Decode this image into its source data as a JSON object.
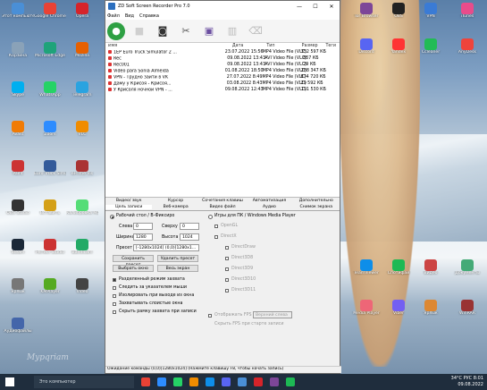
{
  "desktop": {
    "icons_left": [
      {
        "label": "Этот компьютер",
        "color": "#4a8fd6"
      },
      {
        "label": "Google Chrome",
        "color": "#e94235"
      },
      {
        "label": "Opera",
        "color": "#d6242a"
      },
      {
        "label": "Корзина",
        "color": "#8aa2b8"
      },
      {
        "label": "Microsoft Edge",
        "color": "#1fa37a"
      },
      {
        "label": "Mozilla",
        "color": "#e66000"
      },
      {
        "label": "Skype",
        "color": "#00aff0"
      },
      {
        "label": "WhatsApp",
        "color": "#25d366"
      },
      {
        "label": "Telegram",
        "color": "#2aa3e0"
      },
      {
        "label": "Avast",
        "color": "#f07b05"
      },
      {
        "label": "Zoom",
        "color": "#2d8cff"
      },
      {
        "label": "VLC",
        "color": "#f08c00"
      },
      {
        "label": "Paint",
        "color": "#c33"
      },
      {
        "label": "Euro Truck Simulator 2",
        "color": "#335a9a"
      },
      {
        "label": "ePrime Vis",
        "color": "#a33"
      },
      {
        "label": "OBS Studio",
        "color": "#333"
      },
      {
        "label": "Вставить",
        "color": "#d4a017"
      },
      {
        "label": "Калибровка Monitor",
        "color": "#5d7"
      },
      {
        "label": "Steam",
        "color": "#1b2838"
      },
      {
        "label": "Perfect Studio",
        "color": "#c33"
      },
      {
        "label": "Bandicam",
        "color": "#2a6"
      },
      {
        "label": "Ярлык",
        "color": "#777"
      },
      {
        "label": "KMPlayer",
        "color": "#5a2"
      },
      {
        "label": "Video",
        "color": "#444"
      },
      {
        "label": "Аудиофайлы",
        "color": "#46a"
      }
    ],
    "icons_right": [
      {
        "label": "Tor Browser",
        "color": "#7d4698"
      },
      {
        "label": "OBS",
        "color": "#222"
      },
      {
        "label": "VPN",
        "color": "#3a7bd5"
      },
      {
        "label": "iTunes",
        "color": "#e84c8b"
      },
      {
        "label": "Discord",
        "color": "#5865f2"
      },
      {
        "label": "Yandex",
        "color": "#f33"
      },
      {
        "label": "Ccleaner",
        "color": "#2b5"
      },
      {
        "label": "AnyDesk",
        "color": "#ef443b"
      },
      {
        "label": "TeamViewer",
        "color": "#0e8ee9"
      },
      {
        "label": "Спотифай",
        "color": "#1db954"
      },
      {
        "label": "Видео",
        "color": "#c44"
      },
      {
        "label": "Документы",
        "color": "#4a7"
      },
      {
        "label": "Media Player",
        "color": "#e67"
      },
      {
        "label": "Viber",
        "color": "#7360f2"
      },
      {
        "label": "Ярлык",
        "color": "#d83"
      },
      {
        "label": "WinRAR",
        "color": "#933"
      }
    ]
  },
  "app": {
    "title": "ZD Soft Screen Recorder Pro 7.0",
    "menu": [
      "Файл",
      "Вид",
      "Справка"
    ],
    "toolbar": [
      {
        "icon": "record-icon",
        "color": "#2ea043"
      },
      {
        "icon": "stop-icon",
        "color": "#cfcfcf"
      },
      {
        "icon": "camera-icon",
        "color": "#333"
      },
      {
        "icon": "tools-icon",
        "color": "#555"
      },
      {
        "icon": "video-icon",
        "color": "#6b4ea0"
      },
      {
        "icon": "film-icon",
        "color": "#bbb"
      },
      {
        "icon": "trash-icon",
        "color": "#bbb"
      }
    ],
    "file_columns": [
      "Имя",
      "Дата",
      "Тип",
      "Размер",
      "Теги"
    ],
    "files": [
      [
        "1EP Euro Truck Simulator 2 ...",
        "23.07.2022 15:56",
        "MP4 Video File (VLC)",
        "352 597 КБ",
        ""
      ],
      [
        "Rec",
        "09.08.2022 13:43",
        "AVI Video File (VLC)",
        "857 КБ",
        ""
      ],
      [
        "Rec001",
        "09.08.2022 13:43",
        "AVI Video File (VLC)",
        "29 КБ",
        ""
      ],
      [
        "Video para Sonia Almeida",
        "01.08.2022 18:50",
        "MP4 Video File (VLC)",
        "288 347 КБ",
        ""
      ],
      [
        "VPN - Трудно зайти в VK",
        "27.07.2022 8:49",
        "MP4 Video File (VLC)",
        "874 720 КБ",
        ""
      ],
      [
        "Даму у Крисоя - Крисоя...",
        "03.08.2022 8:43",
        "MP4 Video File (VLC)",
        "29 592 КБ",
        ""
      ],
      [
        "У Крисоля ночной VPN - ...",
        "09.08.2022 12:43",
        "MP4 Video File (VLC)",
        "191 530 КБ",
        ""
      ]
    ],
    "tabs_row1": [
      "Видео/ звук",
      "Курсор",
      "Сочетания клавиш",
      "Автоматизация",
      "Дополнительно"
    ],
    "tabs_row2": [
      "Цель записи",
      "Веб-камера",
      "Видео файл",
      "Аудио",
      "Снимок экрана"
    ],
    "panel": {
      "radio_screen": "Рабочий стол / В-Фиксиро",
      "left_label": "Слева",
      "left_value": "0",
      "top_label": "Сверху",
      "top_value": "0",
      "width_label": "Ширина",
      "width_value": "1280",
      "height_label": "Высота",
      "height_value": "1024",
      "preset_label": "Пресет",
      "preset_value": "[-1280x1024] (0,0)[1280x1...",
      "save_preset": "Сохранить пресет",
      "delete_preset": "Удалить пресет",
      "select_window": "Выбрать окно",
      "full_screen": "Весь экран",
      "checks": [
        "Разделенный режим захвата",
        "Следить за указателем мыши",
        "Изолировать при выходе из окна",
        "Захватывать слоистые окна",
        "Скрыть рамку захвата при записи"
      ],
      "radio_games": "Игры для ПК / Windows Media Player",
      "game_options": [
        "OpenGL",
        "DirectX",
        "DirectDraw",
        "Direct3D8",
        "Direct3D9",
        "Direct3D10",
        "Direct3D11"
      ],
      "fps_label": "Отображать FPS",
      "fps_value": "Верхний слева",
      "fps_note": "Скрыть FPS при старте записи"
    },
    "status": "Ожидание команды (0,0)[1280x1024] (Нажмите клавишу F8, чтобы начать запись)"
  },
  "taskbar": {
    "search_placeholder": "Это компьютер",
    "apps": [
      "#e94235",
      "#2d8cff",
      "#25d366",
      "#f08c00",
      "#0e8ee9",
      "#5865f2",
      "#4a8fd6",
      "#d6242a",
      "#7d4698",
      "#1db954"
    ],
    "temperature": "34°C",
    "lang": "РУС",
    "time": "8:01",
    "date": "09.08.2022"
  },
  "watermark": "Mypqriam"
}
